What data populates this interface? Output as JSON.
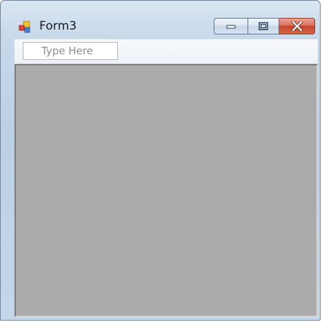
{
  "window": {
    "title": "Form3",
    "icon": "form-app-icon",
    "caption_buttons": {
      "minimize_icon": "minimize-icon",
      "maximize_icon": "maximize-icon",
      "close_icon": "close-icon",
      "close_color": "#c4452b"
    }
  },
  "menustrip": {
    "placeholder": "Type Here"
  },
  "client_area": {
    "background": "#ababab"
  }
}
